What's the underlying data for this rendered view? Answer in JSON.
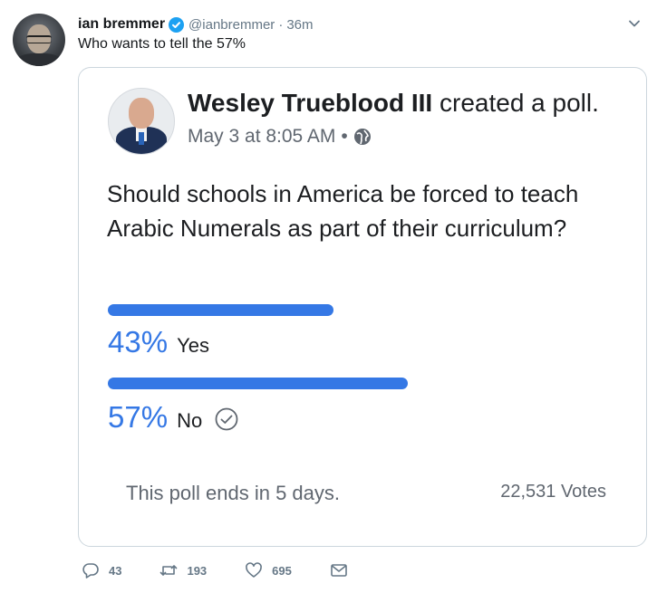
{
  "tweet": {
    "display_name": "ian bremmer",
    "handle": "@ianbremmer",
    "separator": "·",
    "time": "36m",
    "text": "Who wants to tell the 57%"
  },
  "poll_card": {
    "author_name": "Wesley Trueblood III",
    "author_action": " created a poll.",
    "date": "May 3 at 8:05 AM",
    "meta_separator": "•",
    "question": "Should schools in America be forced to teach Arabic Numerals as part of their curriculum?",
    "options": [
      {
        "percent_text": "43%",
        "label": "Yes",
        "fraction": 0.43,
        "selected": false
      },
      {
        "percent_text": "57%",
        "label": "No",
        "fraction": 0.57,
        "selected": true
      }
    ],
    "ends_text": "This poll ends in 5 days.",
    "votes_text": "22,531 Votes",
    "accent_color": "#3578e5"
  },
  "actions": {
    "reply_count": "43",
    "retweet_count": "193",
    "like_count": "695"
  },
  "icons": [
    "verified-badge-icon",
    "chevron-down-icon",
    "globe-icon",
    "check-circle-icon",
    "reply-icon",
    "retweet-icon",
    "like-icon",
    "direct-message-icon"
  ],
  "colors": {
    "verified": "#1da1f2",
    "secondary_text": "#657786"
  }
}
